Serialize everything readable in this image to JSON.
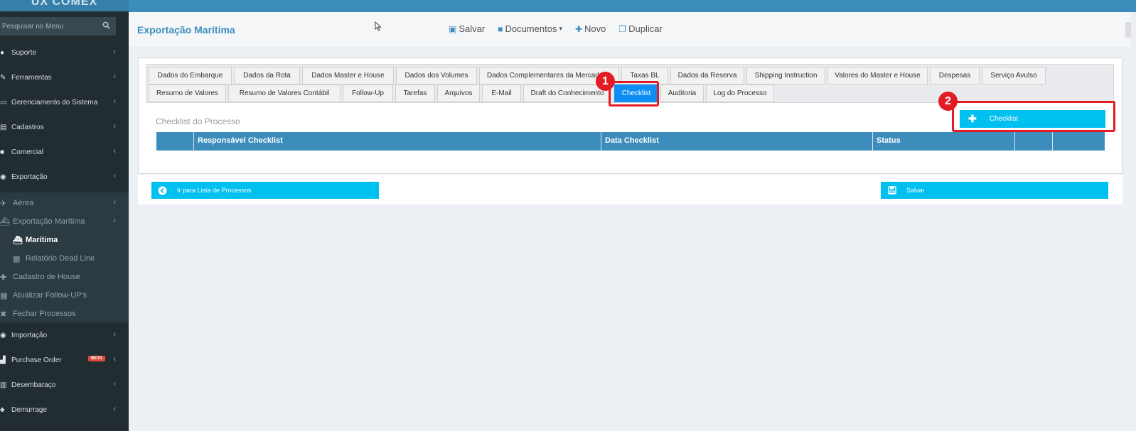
{
  "app": {
    "logo_text": "UX COMEX"
  },
  "topbar": {
    "right_text": ""
  },
  "search": {
    "placeholder": "Pesquisar no Menu"
  },
  "sidebar": {
    "items": [
      {
        "label": "Suporte",
        "icon": "globe-icon"
      },
      {
        "label": "Ferramentas",
        "icon": "wrench-icon"
      },
      {
        "label": "Gerenciamento do Sistema",
        "icon": "laptop-icon"
      },
      {
        "label": "Cadastros",
        "icon": "database-icon"
      },
      {
        "label": "Comercial",
        "icon": "briefcase-icon"
      },
      {
        "label": "Exportação",
        "icon": "arrow-circle-icon"
      },
      {
        "label": "Importação",
        "icon": "arrow-circle-icon"
      },
      {
        "label": "Purchase Order",
        "icon": "chart-icon",
        "badge": "BETA"
      },
      {
        "label": "Desembaraço",
        "icon": "calculator-icon"
      },
      {
        "label": "Demurrage",
        "icon": "users-icon"
      }
    ],
    "sub": [
      {
        "label": "Aérea",
        "icon": "plane-icon"
      },
      {
        "label": "Exportação Marítima",
        "icon": "ship-icon"
      },
      {
        "label": "Marítima",
        "icon": "ship-icon"
      },
      {
        "label": "Relatório Dead Line",
        "icon": "list-icon"
      },
      {
        "label": "Cadastro de House",
        "icon": "plus-icon"
      },
      {
        "label": "Atualizar Follow-UP's",
        "icon": "list-icon"
      },
      {
        "label": "Fechar Processos",
        "icon": "close-icon"
      }
    ]
  },
  "header": {
    "title": "Exportação Marítima"
  },
  "toolbar": {
    "save": "Salvar",
    "documents": "Documentos",
    "new": "Novo",
    "duplicate": "Duplicar"
  },
  "tabs": {
    "row1": [
      "Dados do Embarque",
      "Dados da Rota",
      "Dados Master e House",
      "Dados dos Volumes",
      "Dados Complementares da Mercadoria",
      "Taxas BL",
      "Dados da Reserva",
      "Shipping Instruction",
      "Valores do Master e House",
      "Despesas",
      "Serviço Avulso"
    ],
    "row2": [
      "Resumo de Valores",
      "Resumo de Valores Contábil",
      "Follow-Up",
      "Tarefas",
      "Arquivos",
      "E-Mail",
      "Draft do Conhecimento",
      "Checklist",
      "Auditoria",
      "Log do Processo"
    ]
  },
  "annotations": {
    "badge1": "1",
    "badge2": "2"
  },
  "checklist": {
    "section_title": "Checklist do Processo",
    "add_button": "Checklist",
    "columns": [
      "",
      "Responsável Checklist",
      "Data Checklist",
      "Status",
      "",
      ""
    ]
  },
  "footer": {
    "back_button": "Ir para Lista de Processos",
    "save_button": "Salvar"
  },
  "colors": {
    "accent": "#3c8dbc",
    "button": "#00c0ef",
    "active_tab": "#0e8ef3",
    "annotation": "#e31b23",
    "sidebar": "#222d32"
  }
}
